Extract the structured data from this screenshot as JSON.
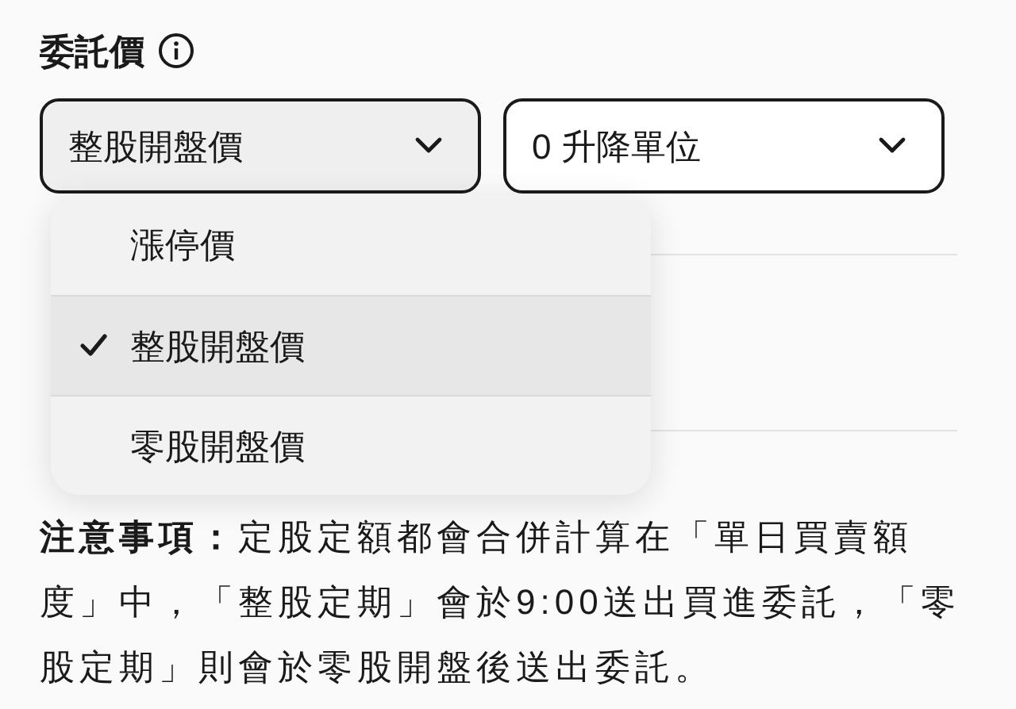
{
  "label": "委託價",
  "selects": [
    {
      "value": "整股開盤價",
      "expanded": true
    },
    {
      "value": "0 升降單位",
      "expanded": false
    }
  ],
  "menu": [
    {
      "label": "漲停價",
      "selected": false
    },
    {
      "label": "整股開盤價",
      "selected": true
    },
    {
      "label": "零股開盤價",
      "selected": false
    }
  ],
  "note": "**注意事項：**定股定額都會合併計算在「單日買賣額度」中，「整股定期」會於9:00送出買進委託，「零股定期」則會於零股開盤後送出委託。"
}
